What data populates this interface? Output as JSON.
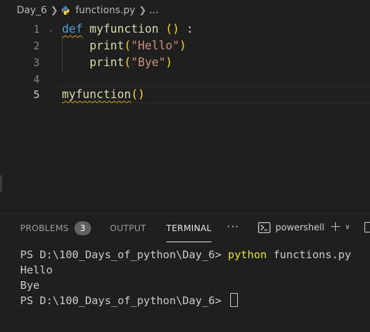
{
  "breadcrumb": {
    "folder": "Day_6",
    "file": "functions.py",
    "more": "..."
  },
  "editor": {
    "line_numbers": [
      "1",
      "2",
      "3",
      "4",
      "5"
    ],
    "lines": {
      "l1": {
        "kw": "def",
        "fn": "myfunction",
        "paren": "()",
        "colon": ":"
      },
      "l2": {
        "fn": "print",
        "open": "(",
        "str": "\"Hello\"",
        "close": ")"
      },
      "l3": {
        "fn": "print",
        "open": "(",
        "str": "\"Bye\"",
        "close": ")"
      },
      "l5": {
        "fn": "myfunction",
        "paren": "()"
      }
    }
  },
  "panel": {
    "tabs": {
      "problems": "PROBLEMS",
      "problems_count": "3",
      "output": "OUTPUT",
      "terminal": "TERMINAL"
    },
    "more": "···",
    "shell": "powershell",
    "add": "+",
    "dropdown": "∨"
  },
  "terminal": {
    "prompt1": "PS D:\\100_Days_of_python\\Day_6> ",
    "command_exe": "python",
    "command_args": " functions.py",
    "output1": "Hello",
    "output2": "Bye",
    "prompt2": "PS D:\\100_Days_of_python\\Day_6> "
  },
  "colors": {
    "background": "#1f1f1f",
    "keyword": "#569cd6",
    "function": "#dcdcaa",
    "string": "#ce9178",
    "bracket": "#ffd700",
    "command": "#e5e510"
  }
}
